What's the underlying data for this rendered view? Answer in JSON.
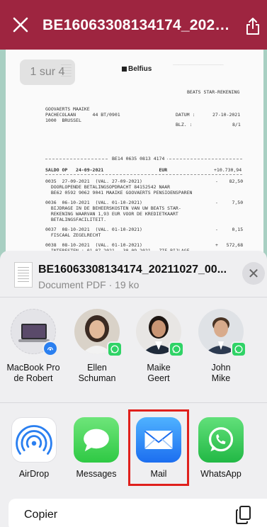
{
  "topbar": {
    "title": "BE16063308134174_20211...",
    "close_icon": "close-icon",
    "share_icon": "share-icon",
    "color": "#9e2540"
  },
  "document": {
    "page_indicator": "1 sur 4",
    "bank": "Belfius",
    "heading": "BEATS STAR-REKENING",
    "address": [
      "GOOVAERTS MAAIKE",
      "PACHECOLAAN      44 BT/0901",
      "1000  BRUSSEL"
    ],
    "datum_label": "DATUM :",
    "datum_value": "27-10-2021",
    "blz_label": "BLZ. :",
    "blz_value": "8/1",
    "account_sep": "BE14 0635 0813 4174",
    "saldo": "SALDO OP   24-09-2021                    EUR",
    "saldo_amount": "+10.730,94",
    "entries": [
      {
        "l1": "0035  27-09-2021  (VAL. 27-09-2021)",
        "l2": "  DOORLOPENDE BETALINGSOPDRACHT 84152542 NAAR",
        "l3": "  BE62 0592 9062 9041 MAAIKE GOOVAERTS PENSIOENSPAREN",
        "amount": "-    82,50"
      },
      {
        "l1": "0036  06-10-2021  (VAL. 01-10-2021)",
        "l2": "  BIJDRAGE IN DE BEHEERSKOSTEN VAN UW BEATS STAR-",
        "l3": "  REKENING WAARVAN 1,93 EUR VOOR DE KREDIETKAART",
        "l4": "  BETALINGSFACILITEIT.",
        "amount": "-     7,50"
      },
      {
        "l1": "0037  08-10-2021  (VAL. 01-10-2021)",
        "l2": "  FISCAAL ZEGELRECHT",
        "amount": "-     0,15"
      },
      {
        "l1": "0038  08-10-2021  (VAL. 01-10-2021)",
        "l2": "  INTERESTEN : 01.07.2021 - 30.09.2021 - ZIE BIJLAGE",
        "amount": "+   572,68"
      }
    ]
  },
  "sheet": {
    "file_name": "BE16063308134174_20211027_00...",
    "file_meta": "Document PDF · 19 ko",
    "close_label": "✕",
    "people": [
      {
        "name_l1": "MacBook Pro",
        "name_l2": "de Robert",
        "type": "airdrop-device"
      },
      {
        "name_l1": "Ellen",
        "name_l2": "Schuman",
        "type": "whatsapp-contact"
      },
      {
        "name_l1": "Maike",
        "name_l2": "Geert",
        "type": "whatsapp-contact"
      },
      {
        "name_l1": "John",
        "name_l2": "Mike",
        "type": "whatsapp-contact"
      }
    ],
    "apps": [
      {
        "label": "AirDrop",
        "icon": "airdrop-icon"
      },
      {
        "label": "Messages",
        "icon": "messages-icon"
      },
      {
        "label": "Mail",
        "icon": "mail-icon"
      },
      {
        "label": "WhatsApp",
        "icon": "whatsapp-icon"
      }
    ],
    "copier_label": "Copier",
    "copier_icon": "copy-icon",
    "highlight_color": "#e0201c"
  }
}
